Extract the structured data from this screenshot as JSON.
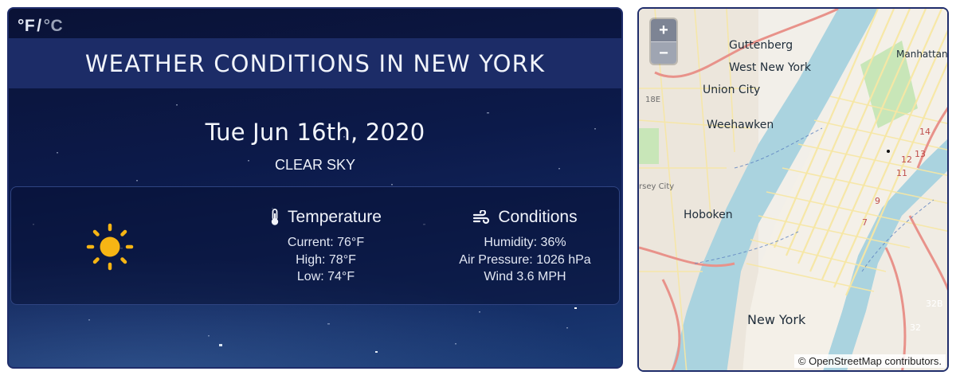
{
  "units": {
    "fahrenheit": "°F",
    "separator": "/",
    "celsius": "°C",
    "active": "fahrenheit"
  },
  "title": "WEATHER CONDITIONS IN NEW YORK",
  "date": "Tue Jun 16th, 2020",
  "description": "CLEAR SKY",
  "weather_icon": "sun-icon",
  "temperature": {
    "heading": "Temperature",
    "icon": "thermometer-icon",
    "current": "Current: 76°F",
    "high": "High: 78°F",
    "low": "Low: 74°F"
  },
  "conditions": {
    "heading": "Conditions",
    "icon": "wind-icon",
    "humidity": "Humidity: 36%",
    "pressure": "Air Pressure: 1026 hPa",
    "wind": "Wind 3.6 MPH"
  },
  "map": {
    "zoom_in": "+",
    "zoom_out": "−",
    "attribution": "© OpenStreetMap contributors.",
    "labels": {
      "guttenberg": "Guttenberg",
      "west_new_york": "West New York",
      "union_city": "Union City",
      "weehawken": "Weehawken",
      "hoboken": "Hoboken",
      "manhattan": "Manhattan",
      "new_york": "New York",
      "jersey_city": "rsey City",
      "r18e": "18E",
      "r14": "14",
      "r13": "13",
      "r12": "12",
      "r11": "11",
      "r9": "9",
      "r7": "7",
      "r32b": "32B",
      "r32": "32"
    }
  },
  "colors": {
    "card_bg": "#0c1a4a",
    "title_bar": "#1c2c67",
    "sun": "#f6b514",
    "water": "#aad3df",
    "land": "#f2efe9",
    "park": "#c8e6b8",
    "highway": "#e8928a",
    "road": "#f7e7a4"
  }
}
